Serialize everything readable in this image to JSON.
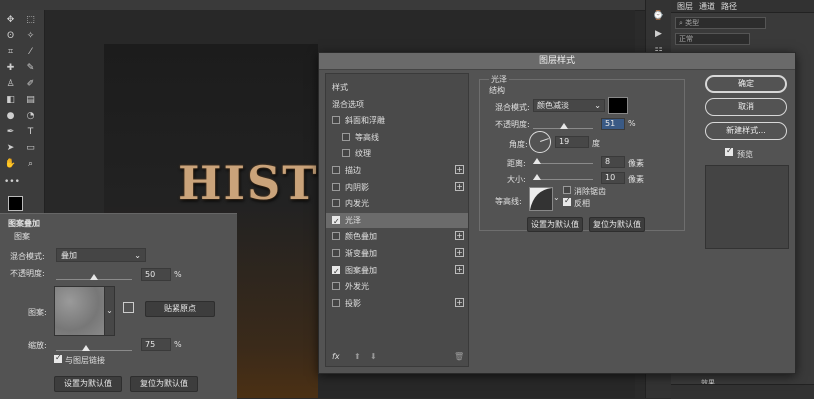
{
  "layers_panel": {
    "tab_layers": "图层",
    "tab_channels": "通道",
    "tab_paths": "路径",
    "filter_placeholder": "类型",
    "blend_mode": "正常",
    "effect_label": "效果"
  },
  "canvas": {
    "text": "HIST"
  },
  "properties_panel": {
    "title": "图案叠加",
    "section": "图案",
    "blend_label": "混合模式:",
    "blend_value": "叠加",
    "opacity_label": "不透明度:",
    "opacity_value": "50",
    "opacity_unit": "%",
    "opacity_level": 0.5,
    "pattern_label": "图案:",
    "snap_button": "贴紧原点",
    "scale_label": "缩放:",
    "scale_value": "75",
    "scale_unit": "%",
    "link_label": "与图层链接",
    "default_button": "设置为默认值",
    "reset_button": "复位为默认值"
  },
  "dialog": {
    "title": "图层样式",
    "styles": [
      {
        "label": "样式",
        "checkbox": false,
        "plus": false
      },
      {
        "label": "混合选项",
        "checkbox": false,
        "plus": false
      },
      {
        "label": "斜面和浮雕",
        "checkbox": true,
        "checked": false,
        "plus": false
      },
      {
        "label": "等高线",
        "checkbox": true,
        "checked": false,
        "plus": false,
        "indent": true
      },
      {
        "label": "纹理",
        "checkbox": true,
        "checked": false,
        "plus": false,
        "indent": true
      },
      {
        "label": "描边",
        "checkbox": true,
        "checked": false,
        "plus": true
      },
      {
        "label": "内阴影",
        "checkbox": true,
        "checked": false,
        "plus": true
      },
      {
        "label": "内发光",
        "checkbox": true,
        "checked": false,
        "plus": false
      },
      {
        "label": "光泽",
        "checkbox": true,
        "checked": true,
        "plus": false,
        "selected": true
      },
      {
        "label": "颜色叠加",
        "checkbox": true,
        "checked": false,
        "plus": true
      },
      {
        "label": "渐变叠加",
        "checkbox": true,
        "checked": false,
        "plus": true
      },
      {
        "label": "图案叠加",
        "checkbox": true,
        "checked": true,
        "plus": true
      },
      {
        "label": "外发光",
        "checkbox": true,
        "checked": false,
        "plus": false
      },
      {
        "label": "投影",
        "checkbox": true,
        "checked": false,
        "plus": true
      }
    ],
    "fx_label": "fx",
    "satin": {
      "title": "光泽",
      "structure": "结构",
      "blend_label": "混合模式:",
      "blend_value": "颜色减淡",
      "color": "#000000",
      "opacity_label": "不透明度:",
      "opacity_value": "51",
      "opacity_unit": "%",
      "opacity_level": 0.51,
      "angle_label": "角度:",
      "angle_value": "19",
      "angle_unit": "度",
      "distance_label": "距离:",
      "distance_value": "8",
      "distance_unit": "像素",
      "size_label": "大小:",
      "size_value": "10",
      "size_unit": "像素",
      "contour_label": "等高线:",
      "antialias_label": "消除锯齿",
      "invert_label": "反相",
      "default_button": "设置为默认值",
      "reset_button": "复位为默认值"
    },
    "ok_button": "确定",
    "cancel_button": "取消",
    "new_style_button": "新建样式...",
    "preview_label": "预览"
  }
}
